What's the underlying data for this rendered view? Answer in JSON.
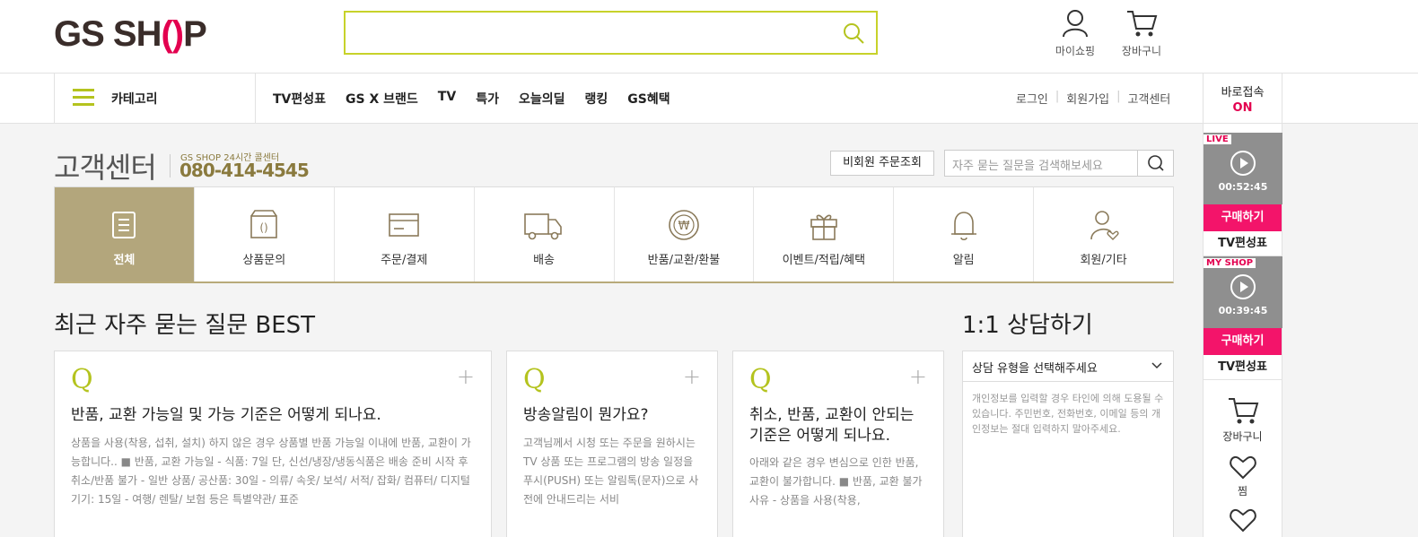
{
  "header": {
    "logo": "GS SHOP",
    "logo_pre": "GS SH",
    "logo_o": "()",
    "logo_post": "P",
    "mypage": "마이쇼핑",
    "cart": "장바구니"
  },
  "nav": {
    "category": "카테고리",
    "menu": [
      "TV편성표",
      "GS X 브랜드",
      "TV",
      "특가",
      "오늘의딜",
      "랭킹",
      "GS혜택"
    ],
    "login": "로그인",
    "join": "회원가입",
    "cs": "고객센터",
    "direct": "바로접속",
    "direct_state": "ON"
  },
  "cs": {
    "title": "고객센터",
    "sub": "GS SHOP 24시간 콜센터",
    "phone": "080-414-4545",
    "guest_btn": "비회원 주문조회",
    "search_placeholder": "자주 묻는 질문을 검색해보세요"
  },
  "categories": [
    {
      "label": "전체",
      "icon": "list-icon"
    },
    {
      "label": "상품문의",
      "icon": "box-icon"
    },
    {
      "label": "주문/결제",
      "icon": "card-icon"
    },
    {
      "label": "배송",
      "icon": "truck-icon"
    },
    {
      "label": "반품/교환/환불",
      "icon": "refund-icon"
    },
    {
      "label": "이벤트/적립/혜택",
      "icon": "gift-icon"
    },
    {
      "label": "알림",
      "icon": "bell-icon"
    },
    {
      "label": "회원/기타",
      "icon": "member-icon"
    }
  ],
  "best": {
    "title": "최근 자주 묻는 질문 BEST",
    "cards": [
      {
        "q": "Q",
        "title": "반품, 교환 가능일 및 가능 기준은 어떻게 되나요.",
        "desc": "상품을 사용(착용, 섭취, 설치) 하지 않은 경우 상품별 반품 가능일 이내에 반품, 교환이 가능합니다.. ■ 반품, 교환 가능일 - 식품: 7일 단, 신선/냉장/냉동식품은 배송 준비 시작 후 취소/반품 불가 - 일반 상품/ 공산품: 30일 - 의류/ 속옷/ 보석/ 서적/ 잡화/ 컴퓨터/ 디지털 기기: 15일 - 여행/ 렌탈/ 보험 등은 특별약관/ 표준"
      },
      {
        "q": "Q",
        "title": "방송알림이 뭔가요?",
        "desc": "고객님께서 시청 또는 주문을 원하시는 TV 상품 또는 프로그램의 방송 일정을 푸시(PUSH) 또는 알림톡(문자)으로 사전에 안내드리는 서비"
      },
      {
        "q": "Q",
        "title": "취소, 반품, 교환이 안되는 기준은 어떻게 되나요.",
        "desc": "아래와 같은 경우 변심으로 인한 반품, 교환이 불가합니다. ■ 반품, 교환 불가 사유 - 상품을 사용(착용,"
      }
    ]
  },
  "consult": {
    "title": "1:1 상담하기",
    "select": "상담 유형을 선택해주세요",
    "note": "개인정보를 입력할 경우 타인에 의해 도용될 수 있습니다. 주민번호, 전화번호, 이메일 등의 개인정보는 절대 입력하지 말아주세요."
  },
  "sidebar": {
    "live": {
      "tag": "LIVE",
      "time": "00:52:45",
      "buy": "구매하기",
      "schedule": "TV편성표"
    },
    "myshop": {
      "tag": "MY SHOP",
      "time": "00:39:45",
      "buy": "구매하기",
      "schedule": "TV편성표"
    },
    "cart": "장바구니",
    "wish": "찜"
  }
}
